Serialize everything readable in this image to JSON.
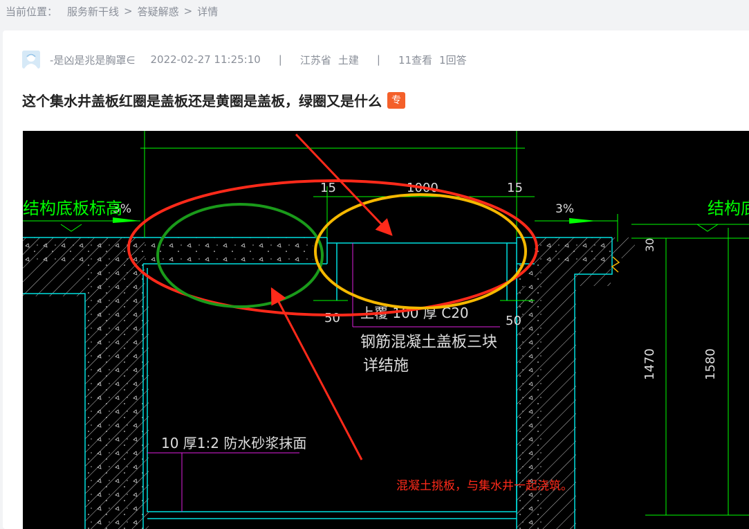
{
  "breadcrumb": {
    "label": "当前位置：",
    "items": [
      "服务新干线",
      "答疑解惑",
      "详情"
    ],
    "separator": ">"
  },
  "post": {
    "author": "-是凶是兆是胸罩∈",
    "date": "2022-02-27 11:25:10",
    "province": "江苏省",
    "category": "土建",
    "views": "11查看",
    "answers": "1回答",
    "separator": "|",
    "title": "这个集水井盖板红圈是盖板还是黄圈是盖板，绿圈又是什么",
    "badge": "专"
  },
  "drawing": {
    "left_label": "结构底板标高",
    "right_label": "结构底",
    "slope_left": "3%",
    "slope_right": "3%",
    "dim_15_left": "15",
    "dim_1000": "1000",
    "dim_15_right": "15",
    "dim_50_left": "50",
    "dim_50_right": "50",
    "dim_30": "30",
    "dim_1470": "1470",
    "dim_1580": "1580",
    "note_cover_1": "上覆 100 厚 C20",
    "note_cover_2": "钢筋混凝土盖板三块",
    "note_cover_3": "详结施",
    "note_mortar": "10 厚1:2 防水砂浆抹面",
    "annotation": "混凝土挑板，与集水井一起浇筑。",
    "colors": {
      "background": "#000000",
      "concrete_line": "#00e0e0",
      "dimension": "#00ff00",
      "red_circle": "#ff2a1a",
      "yellow_circle": "#f5b800",
      "green_circle": "#1a9a1a",
      "magenta": "#e020e0",
      "annotation": "#ff2a1a"
    }
  }
}
